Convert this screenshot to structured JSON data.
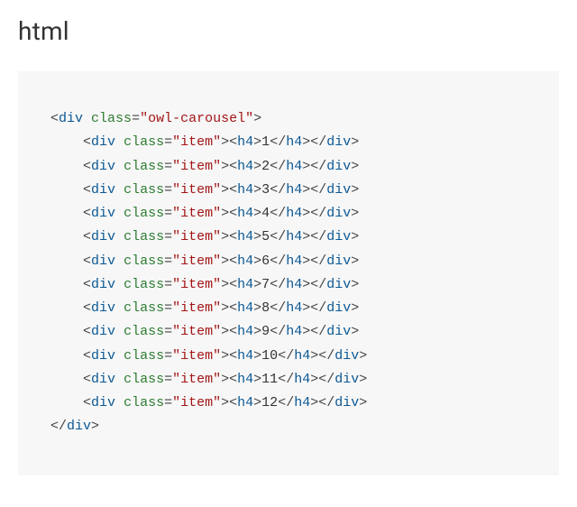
{
  "heading": "html",
  "code": {
    "wrapper_open": {
      "tag": "div",
      "attr": "class",
      "value": "\"owl-carousel\""
    },
    "item_attr": "class",
    "item_value": "\"item\"",
    "item_tag": "div",
    "inner_tag": "h4",
    "values": [
      "1",
      "2",
      "3",
      "4",
      "5",
      "6",
      "7",
      "8",
      "9",
      "10",
      "11",
      "12"
    ],
    "wrapper_close_tag": "div"
  }
}
